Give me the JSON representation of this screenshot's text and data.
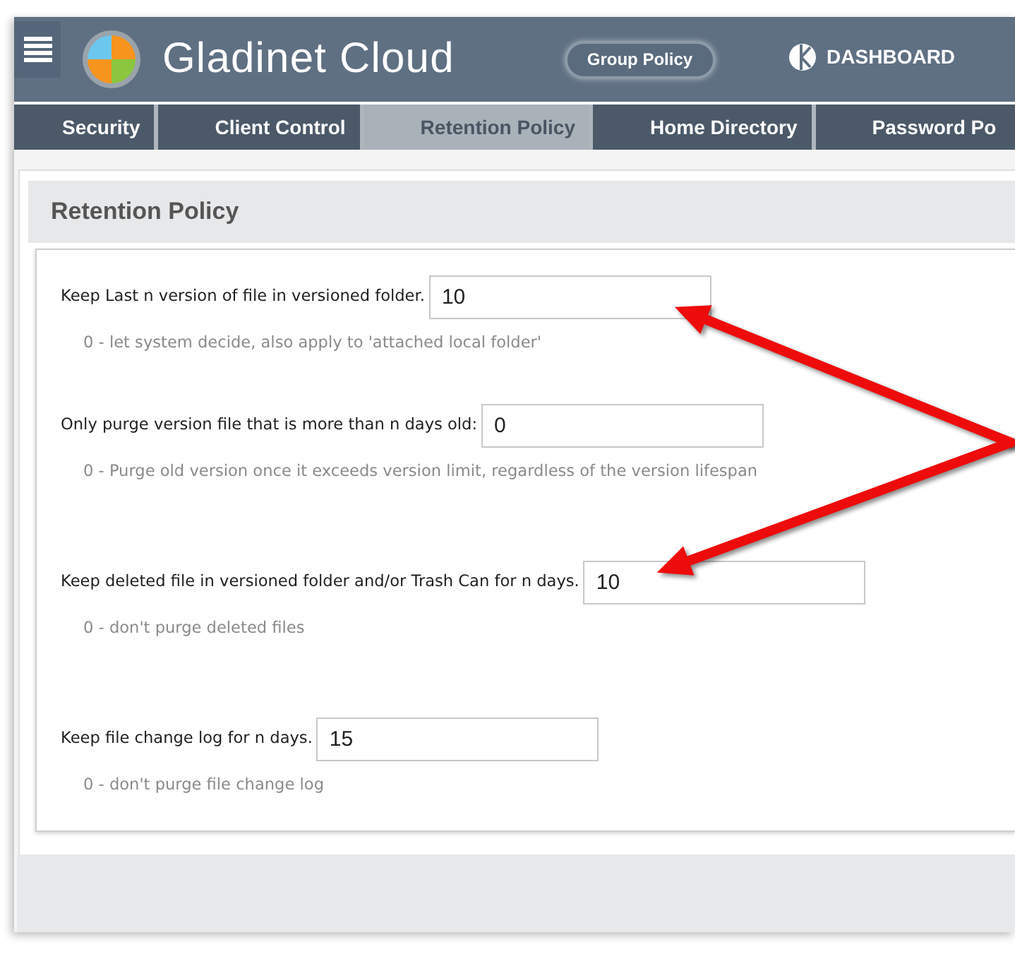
{
  "header": {
    "brand": "Gladinet Cloud",
    "group_button": "Group Policy",
    "dashboard_link": "DASHBOARD"
  },
  "tabs": [
    {
      "label": "Security",
      "selected": false
    },
    {
      "label": "Client Control",
      "selected": false
    },
    {
      "label": "Retention Policy",
      "selected": true
    },
    {
      "label": "Home Directory",
      "selected": false
    },
    {
      "label": "Password Po",
      "selected": false
    }
  ],
  "panel": {
    "title": "Retention Policy"
  },
  "fields": [
    {
      "label": "Keep Last n version of file in versioned folder.",
      "value": "10",
      "hint": "0 - let system decide, also apply to 'attached local folder'",
      "pointed_at": true
    },
    {
      "label": "Only purge version file that is more than n days old:",
      "value": "0",
      "hint": "0 - Purge old version once it exceeds version limit, regardless of the version lifespan",
      "pointed_at": false
    },
    {
      "label": "Keep deleted file in versioned folder and/or Trash Can for n days.",
      "value": "10",
      "hint": "0 - don't purge deleted files",
      "pointed_at": true
    },
    {
      "label": "Keep file change log for n days.",
      "value": "15",
      "hint": "0 - don't purge file change log",
      "pointed_at": false
    }
  ]
}
